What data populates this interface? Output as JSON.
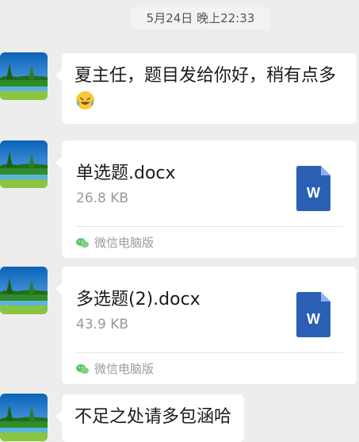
{
  "timestamp": "5月24日 晚上22:33",
  "messages": [
    {
      "type": "text",
      "text": "夏主任，题目发给你好，稍有点多",
      "emoji": "laughing-crying-emoji"
    },
    {
      "type": "file",
      "name": "单选题.docx",
      "size": "26.8 KB",
      "source": "微信电脑版"
    },
    {
      "type": "file",
      "name": "多选题(2).docx",
      "size": "43.9 KB",
      "source": "微信电脑版"
    },
    {
      "type": "text",
      "text": "不足之处请多包涵哈"
    }
  ],
  "colors": {
    "background": "#ededed",
    "bubble": "#ffffff",
    "word_icon": "#2b5fb4",
    "wechat_green": "#5ec36f"
  }
}
